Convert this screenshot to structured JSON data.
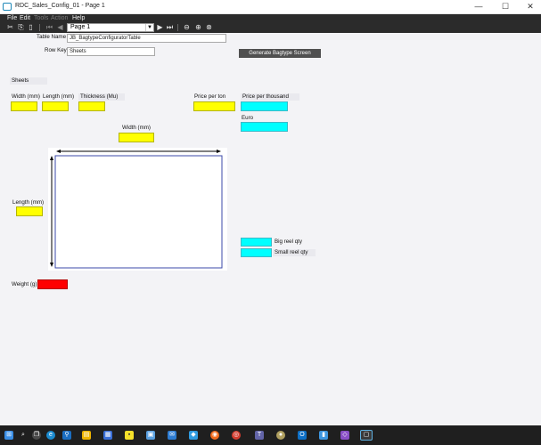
{
  "window": {
    "title": "RDC_Sales_Config_01 - Page 1"
  },
  "window_controls": {
    "minimize": "—",
    "maximize": "☐",
    "close": "✕"
  },
  "menu": [
    {
      "label": "File",
      "enabled": true
    },
    {
      "label": "Edit",
      "enabled": true
    },
    {
      "label": "Tools",
      "enabled": false
    },
    {
      "label": "Action",
      "enabled": false
    },
    {
      "label": "Help",
      "enabled": true
    }
  ],
  "toolbar": {
    "icons": [
      "cut-icon",
      "copy-icon",
      "paste-icon",
      "first-page-icon",
      "prev-page-icon",
      "next-page-icon",
      "last-page-icon",
      "back-icon",
      "forward-icon",
      "stop-icon"
    ],
    "page_select_value": "Page 1"
  },
  "form": {
    "table_name_label": "Table Name",
    "table_name_value": "JB_BagtypeConfiguratorTable",
    "row_key_label": "Row Key",
    "row_key_value": "Sheets",
    "generate_button": "Generate Bagtype Screen",
    "section_label": "Sheets",
    "width_mm_label": "Width (mm)",
    "length_mm_label": "Length (mm)",
    "thickness_label": "Thickness (Mu)",
    "price_per_ton_label": "Price per ton",
    "price_per_thousand_label": "Price per thousand",
    "euro_label": "Euro",
    "diagram_width_label": "Width (mm)",
    "diagram_length_label": "Length (mm)",
    "big_reel_label": "Big reel qty",
    "small_reel_label": "Small reel qty",
    "weight_label": "Weight (g)"
  },
  "colors": {
    "input_yellow": "#ffff00",
    "output_cyan": "#00ffff",
    "weight_red": "#ff0000",
    "diagram_border": "#3b4aa8"
  },
  "taskbar": {
    "icons": [
      "windows-start-icon",
      "search-icon",
      "edge-icon",
      "maps-icon",
      "app-icon",
      "store-icon",
      "sticky-notes-icon",
      "photos-icon",
      "mail-icon",
      "firefox-icon",
      "chrome-icon",
      "teams-icon",
      "app2-icon",
      "outlook-icon",
      "files-icon",
      "app3-icon",
      "app4-icon",
      "rdc-app-icon"
    ]
  }
}
